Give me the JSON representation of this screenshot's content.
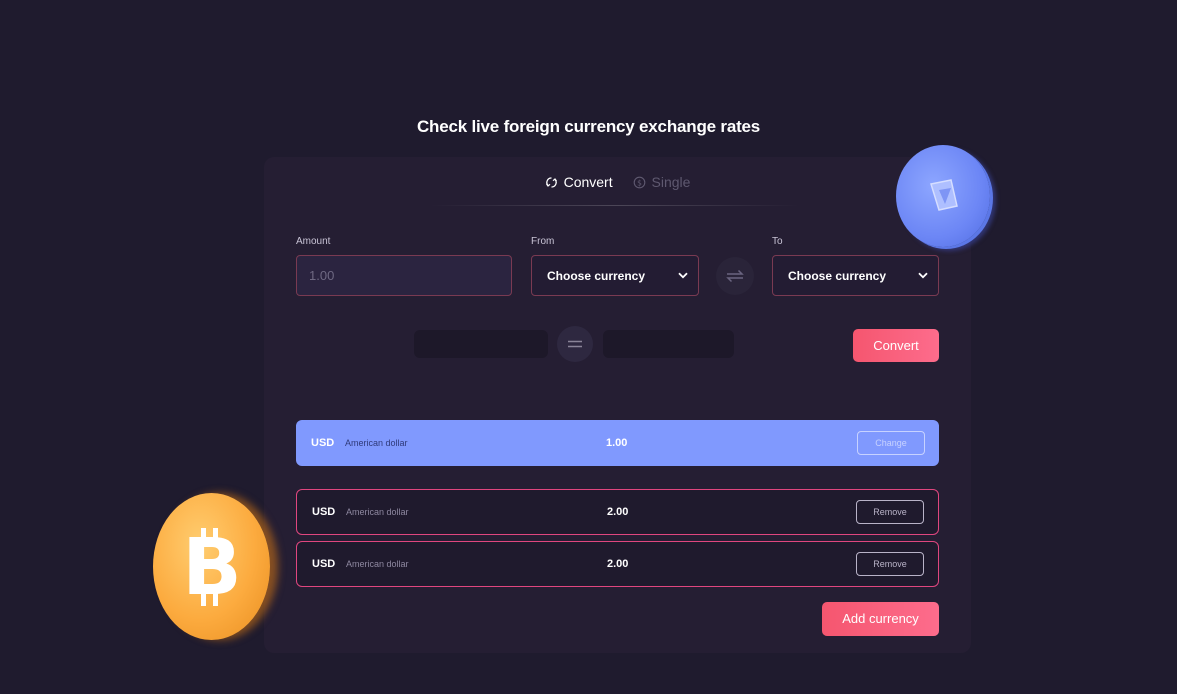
{
  "page": {
    "title": "Check live foreign currency exchange rates"
  },
  "tabs": [
    {
      "label": "Convert",
      "icon": "convert-icon",
      "active": true
    },
    {
      "label": "Single",
      "icon": "dollar-coin-icon",
      "active": false
    }
  ],
  "form": {
    "amount": {
      "label": "Amount",
      "placeholder": "1.00",
      "value": ""
    },
    "from": {
      "label": "From",
      "selected": "Choose currency"
    },
    "to": {
      "label": "To",
      "selected": "Choose currency"
    },
    "swap_icon": "swap-arrows-icon",
    "equals_icon": "equals-icon",
    "convert_label": "Convert"
  },
  "list": {
    "base": {
      "code": "USD",
      "name": "American dollar",
      "value": "1.00",
      "button": "Change"
    },
    "rows": [
      {
        "code": "USD",
        "name": "American dollar",
        "value": "2.00",
        "button": "Remove"
      },
      {
        "code": "USD",
        "name": "American dollar",
        "value": "2.00",
        "button": "Remove"
      }
    ],
    "add_label": "Add currency"
  },
  "colors": {
    "background": "#1f1b2e",
    "card": "#251e33",
    "accent_pink": "#f5566f",
    "accent_blue": "#8099fe",
    "input_border": "#7a3a52",
    "row_border": "#e0467f"
  },
  "decorations": {
    "left_coin": "bitcoin-coin-icon",
    "right_coin": "ethereum-coin-icon"
  }
}
